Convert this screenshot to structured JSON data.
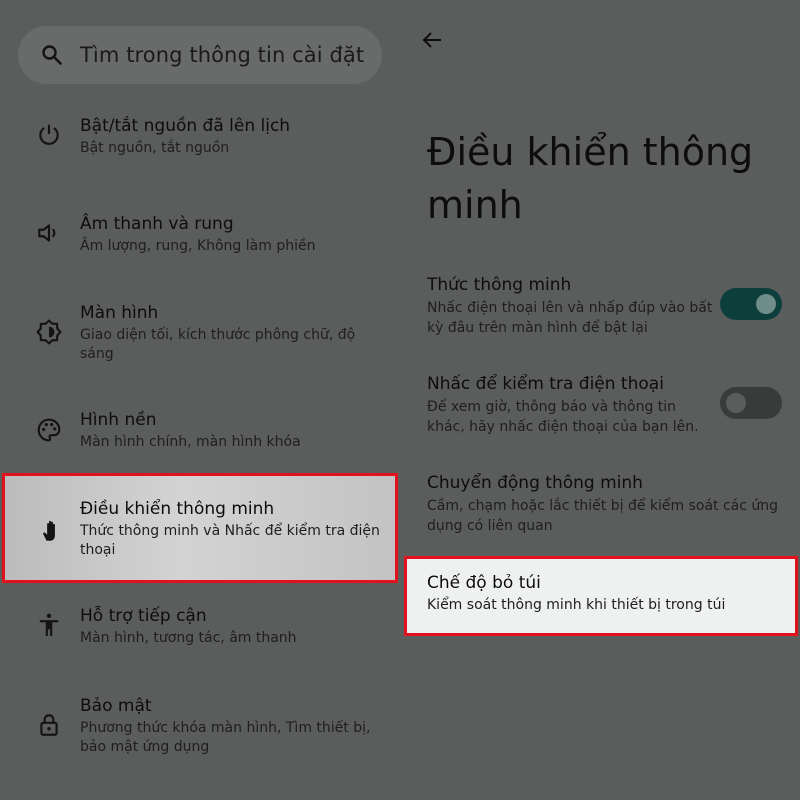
{
  "search": {
    "placeholder": "Tìm trong thông tin cài đặt",
    "icon": "search-icon"
  },
  "settings_list": [
    {
      "key": "schedule",
      "icon": "power-icon",
      "title": "Bật/tắt nguồn đã lên lịch",
      "subtitle": "Bật nguồn, tắt nguồn"
    },
    {
      "key": "sound",
      "icon": "volume-icon",
      "title": "Âm thanh và rung",
      "subtitle": "Âm lượng, rung, Không làm phiền"
    },
    {
      "key": "display",
      "icon": "brightness-icon",
      "title": "Màn hình",
      "subtitle": "Giao diện tối, kích thước phông chữ, độ sáng"
    },
    {
      "key": "wallpaper",
      "icon": "palette-icon",
      "title": "Hình nền",
      "subtitle": "Màn hình chính, màn hình khóa"
    },
    {
      "key": "smart",
      "icon": "hand-icon",
      "title": "Điều khiển thông minh",
      "subtitle": "Thức thông minh và Nhấc để kiểm tra điện thoại",
      "selected": true
    },
    {
      "key": "accessibility",
      "icon": "accessibility-icon",
      "title": "Hỗ trợ tiếp cận",
      "subtitle": "Màn hình, tương tác, âm thanh"
    },
    {
      "key": "security",
      "icon": "lock-icon",
      "title": "Bảo mật",
      "subtitle": "Phương thức khóa màn hình, Tìm thiết bị, bảo mật ứng dụng"
    }
  ],
  "detail": {
    "title": "Điều khiển thông minh",
    "prefs": [
      {
        "key": "smart_wake",
        "title": "Thức thông minh",
        "subtitle": "Nhấc điện thoại lên và nhấp đúp vào bất kỳ đâu trên màn hình để bật lại",
        "switch": true,
        "on": true
      },
      {
        "key": "lift_check",
        "title": "Nhấc để kiểm tra điện thoại",
        "subtitle": "Để xem giờ, thông báo và thông tin khác, hãy nhấc điện thoại của bạn lên.",
        "switch": true,
        "on": false
      },
      {
        "key": "smart_motion",
        "title": "Chuyển động thông minh",
        "subtitle": "Cầm, chạm hoặc lắc thiết bị để kiểm soát các ứng dụng có liên quan",
        "switch": false
      },
      {
        "key": "pocket_mode",
        "title": "Chế độ bỏ túi",
        "subtitle": "Kiểm soát thông minh khi thiết bị trong túi",
        "switch": false,
        "highlighted": true
      }
    ]
  },
  "colors": {
    "dim_background": "#5b5c5c",
    "highlight_border": "#e1121b",
    "switch_on_track": "#0c3f3b",
    "switch_off_track": "#393a3a"
  }
}
